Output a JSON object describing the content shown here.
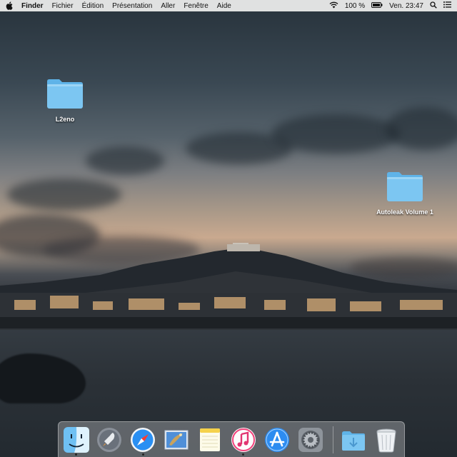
{
  "menubar": {
    "app_name": "Finder",
    "menus": [
      "Fichier",
      "Édition",
      "Présentation",
      "Aller",
      "Fenêtre",
      "Aide"
    ],
    "battery": "100 %",
    "clock": "Ven. 23:47"
  },
  "desktop": {
    "icons": [
      {
        "label": "L2eno"
      },
      {
        "label": "Autoleak Volume 1"
      }
    ]
  },
  "dock": {
    "items": [
      {
        "icon": "finder-icon",
        "running": true
      },
      {
        "icon": "launchpad-icon",
        "running": false
      },
      {
        "icon": "safari-icon",
        "running": true
      },
      {
        "icon": "mail-icon",
        "running": false
      },
      {
        "icon": "notes-icon",
        "running": false
      },
      {
        "icon": "itunes-icon",
        "running": true
      },
      {
        "icon": "app-store-icon",
        "running": false
      },
      {
        "icon": "system-preferences-icon",
        "running": false
      },
      {
        "icon": "downloads-folder-icon",
        "running": false
      },
      {
        "icon": "trash-icon",
        "running": false
      }
    ]
  }
}
